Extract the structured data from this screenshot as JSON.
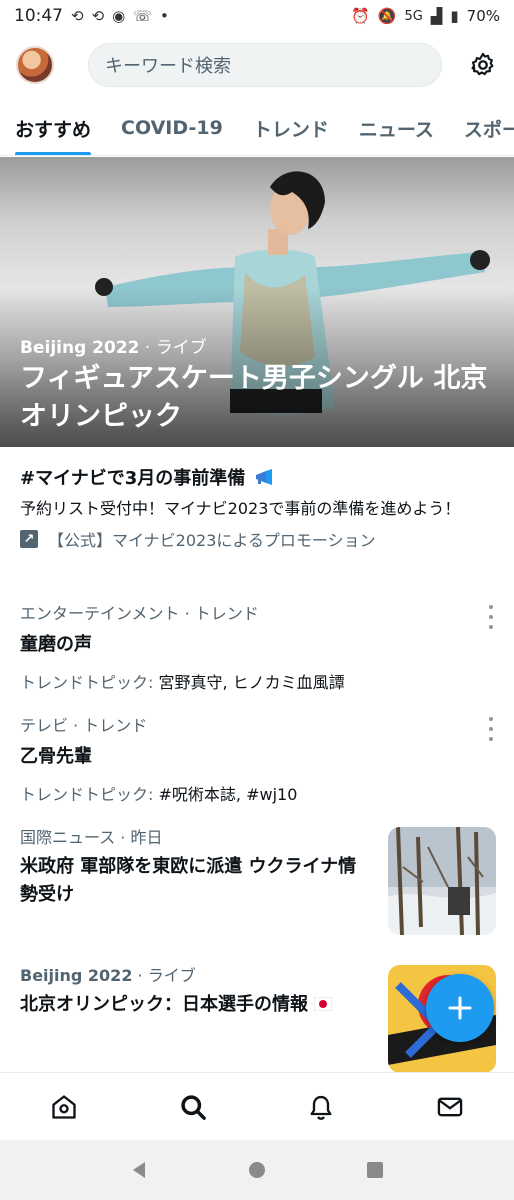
{
  "status_bar": {
    "time": "10:47",
    "signal": "5G",
    "battery": "70%",
    "dot": "•"
  },
  "header": {
    "search_placeholder": "キーワード検索"
  },
  "tabs": [
    {
      "label": "おすすめ",
      "active": true
    },
    {
      "label": "COVID-19",
      "active": false
    },
    {
      "label": "トレンド",
      "active": false
    },
    {
      "label": "ニュース",
      "active": false
    },
    {
      "label": "スポー",
      "active": false
    }
  ],
  "hero": {
    "category": "Beijing 2022",
    "status": "· ライブ",
    "title": "フィギュアスケート男子シングル 北京オリンピック"
  },
  "promo": {
    "title": "#マイナビで3月の事前準備",
    "body": "予約リスト受付中！マイナビ2023で事前の準備を進めよう！",
    "promoted_by": "【公式】マイナビ2023によるプロモーション"
  },
  "trends": [
    {
      "meta": "エンターテインメント · トレンド",
      "title": "童磨の声",
      "sub_label": "トレンドトピック:",
      "sub_value": "宮野真守, ヒノカミ血風譚"
    },
    {
      "meta": "テレビ · トレンド",
      "title": "乙骨先輩",
      "sub_label": "トレンドトピック:",
      "sub_value": "#呪術本誌, #wj10"
    }
  ],
  "news": [
    {
      "meta": "国際ニュース · 昨日",
      "title": "米政府 軍部隊を東欧に派遣 ウクライナ情勢受け"
    },
    {
      "meta_strong": "Beijing 2022",
      "meta": " · ライブ",
      "title": "北京オリンピック：日本選手の情報"
    }
  ],
  "colors": {
    "accent": "#1d9bf0",
    "text": "#0f1419",
    "secondary": "#536471"
  },
  "icons": {
    "home": "home-icon",
    "search": "search-icon",
    "bell": "notifications-icon",
    "mail": "messages-icon",
    "gear": "gear-icon",
    "plus": "plus-icon"
  }
}
